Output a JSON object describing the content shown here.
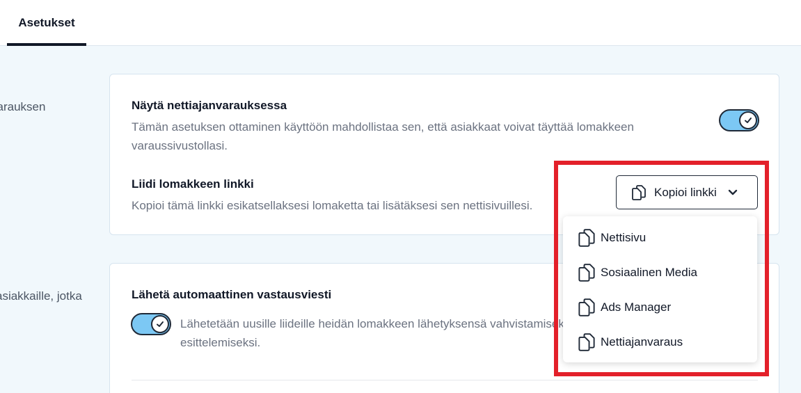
{
  "tabs": {
    "active": "Asetukset"
  },
  "side_labels": {
    "first": "varauksen",
    "second": "asiakkaille, jotka"
  },
  "section1": {
    "title": "Näytä nettiajanvarauksessa",
    "desc_line1": "Tämän asetuksen ottaminen käyttöön mahdollistaa sen, että asiakkaat voivat täyttää lomakkeen",
    "desc_line2": "varaussivustollasi.",
    "toggle_on": true
  },
  "section2": {
    "title": "Liidi lomakkeen linkki",
    "desc": "Kopioi tämä linkki esikatsellaksesi lomaketta tai lisätäksesi sen nettisivuillesi.",
    "button_label": "Kopioi linkki"
  },
  "dropdown": {
    "items": [
      {
        "label": "Nettisivu",
        "icon": "copy-icon"
      },
      {
        "label": "Sosiaalinen Media",
        "icon": "copy-icon"
      },
      {
        "label": "Ads Manager",
        "icon": "copy-icon"
      },
      {
        "label": "Nettiajanvaraus",
        "icon": "copy-icon"
      }
    ]
  },
  "section3": {
    "title": "Lähetä automaattinen vastausviesti",
    "desc_line1": "Lähetetään uusille liideille heidän lomakkeen lähetyksensä vahvistamiseksi ja yrityksen",
    "desc_line2": "esittelemiseksi.",
    "toggle_on": true
  },
  "colors": {
    "accent": "#7cc8f4",
    "highlight": "#e3202a",
    "background": "#f1f8fc"
  }
}
